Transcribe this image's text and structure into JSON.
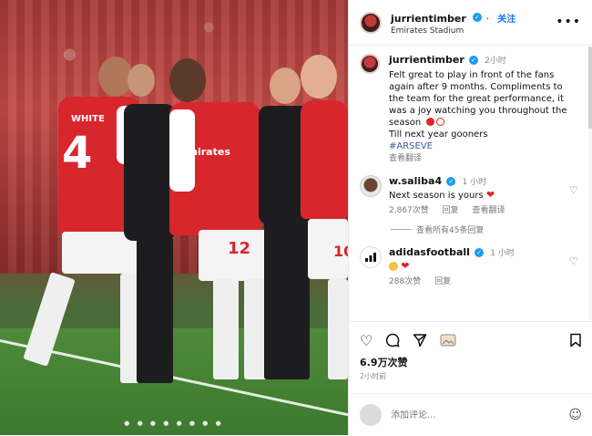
{
  "header": {
    "username": "jurrientimber",
    "follow_label": "关注",
    "location": "Emirates Stadium"
  },
  "post": {
    "username": "jurrientimber",
    "time": "2小时",
    "caption": "Felt great to play in front of the fans again after 9 months. Compliments to the team for the great performance, it was a joy watching you throughout the season",
    "caption_tail": "Till next year gooners",
    "hashtag": "#ARSEVE",
    "translate_label": "查看翻译"
  },
  "photo": {
    "player_left_name": "WHITE",
    "player_left_number": "4",
    "player_right_number": "12",
    "player_far_right_number": "10",
    "sponsor": "Emirates",
    "carousel_indicator": "● ● ● ● ● ● ● ●"
  },
  "comments": [
    {
      "username": "w.saliba4",
      "time": "1 小时",
      "text": "Next season is yours",
      "likes": "2,867次赞",
      "reply_label": "回复",
      "translate_label": "查看翻译",
      "view_replies": "查看所有45条回复"
    },
    {
      "username": "adidasfootball",
      "time": "1 小时",
      "likes": "288次赞",
      "reply_label": "回复"
    }
  ],
  "actions": {
    "likes_count": "6.9万次赞",
    "posted_ago": "2小时前",
    "comment_placeholder": "添加评论..."
  },
  "icons": {
    "like": "heart-outline-icon",
    "comment": "speech-bubble-icon",
    "share": "paper-plane-icon",
    "bookmark": "bookmark-icon",
    "more": "more-dots-icon",
    "emoji": "smiley-icon"
  },
  "colors": {
    "follow_blue": "#1877f2",
    "verified_blue": "#1d9bf0",
    "arsenal_red": "#d8262d",
    "heart_red": "#e02424"
  }
}
